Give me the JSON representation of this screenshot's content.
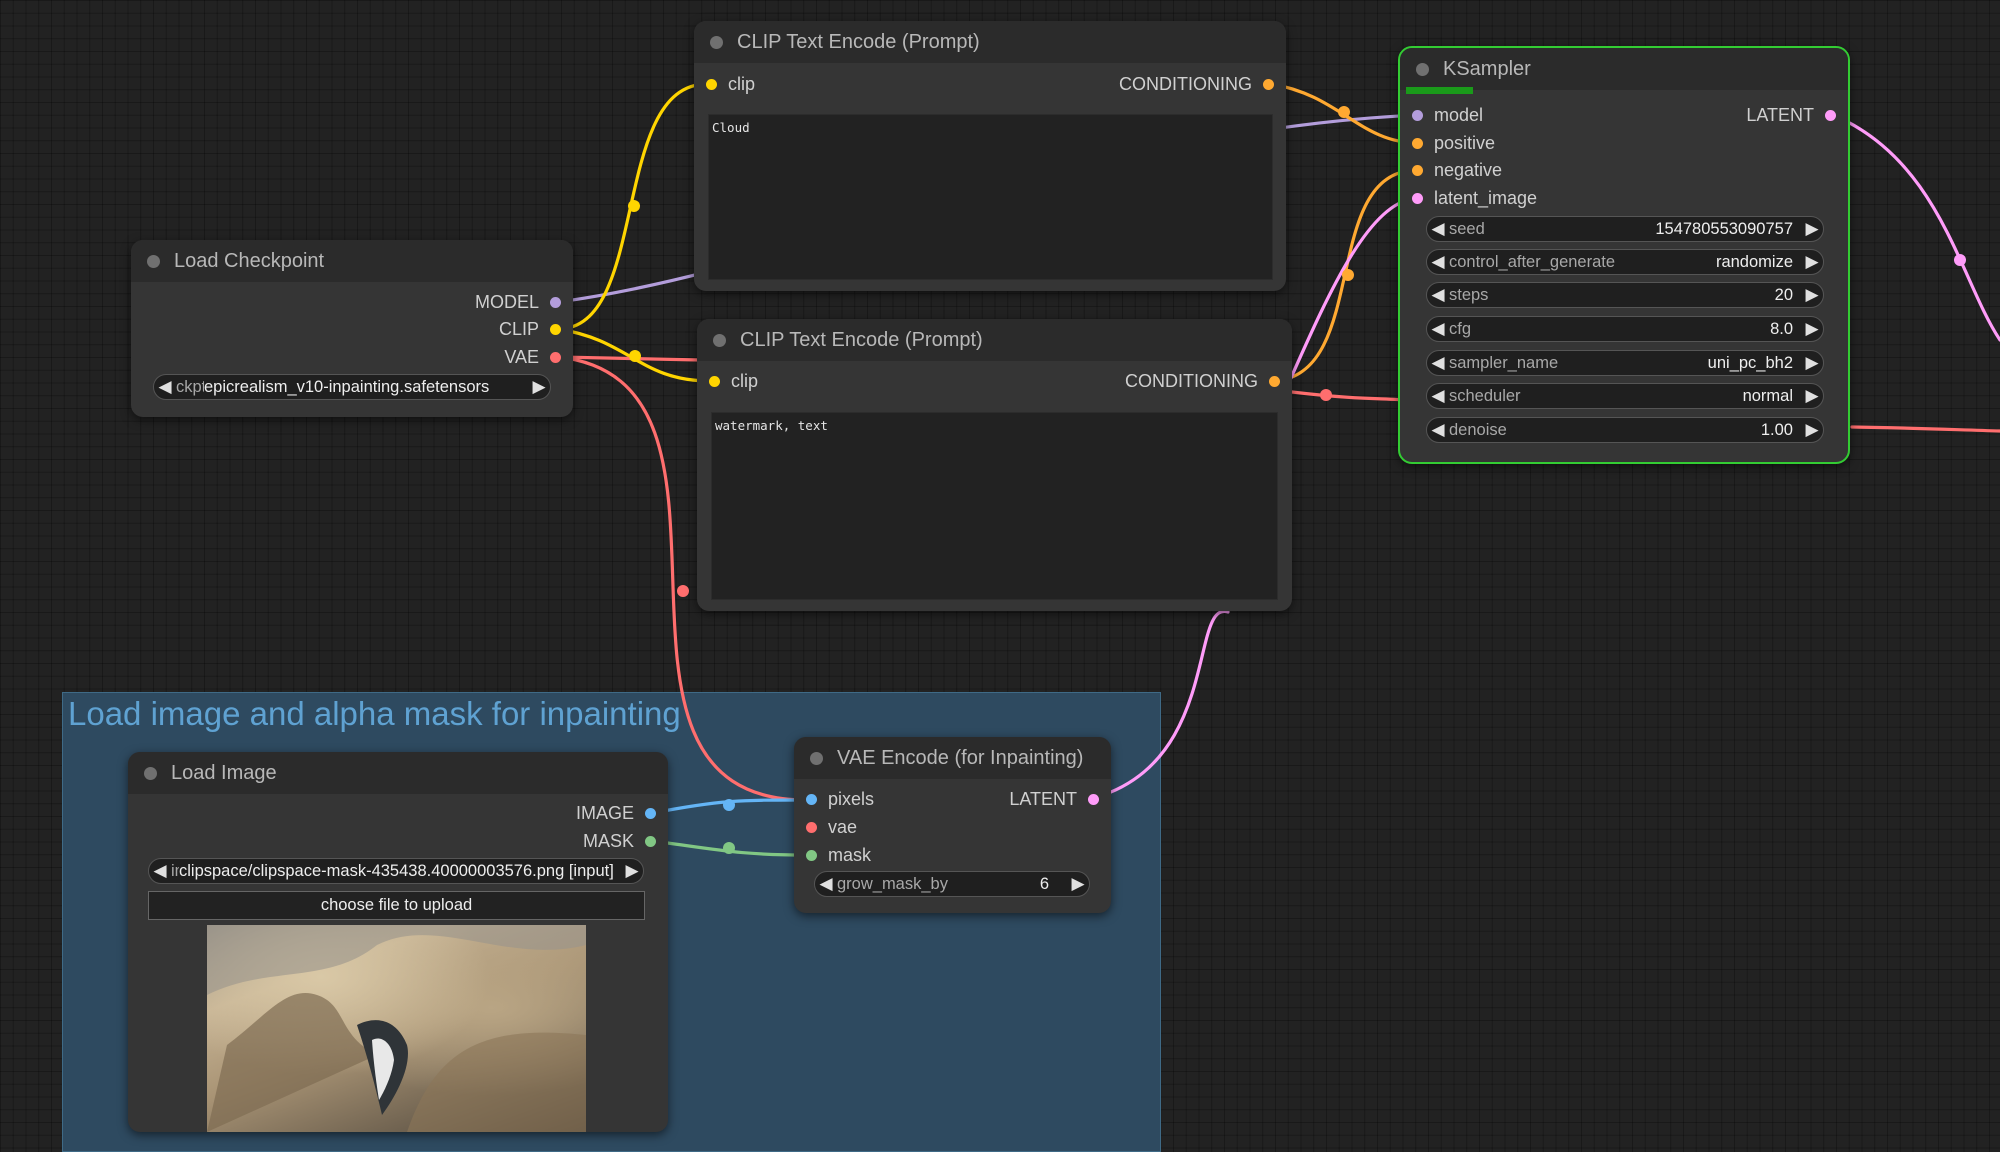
{
  "group": {
    "title": "Load image and alpha mask for inpainting"
  },
  "colors": {
    "model": "#b39ddb",
    "clip": "#ffd500",
    "vae": "#ff6e6e",
    "conditioning": "#ffa931",
    "latent": "#ff9cf9",
    "image": "#64b5f6",
    "mask": "#81c784",
    "selected_border": "#33cc33",
    "group_fill": "#2e4a60",
    "group_title": "#5fa2d2"
  },
  "load_checkpoint": {
    "title": "Load Checkpoint",
    "outputs": {
      "model": "MODEL",
      "clip": "CLIP",
      "vae": "VAE"
    },
    "ckpt": {
      "label": "ckpt_name",
      "value": "epicrealism_v10-inpainting.safetensors"
    }
  },
  "clip_pos": {
    "title": "CLIP Text Encode (Prompt)",
    "input": "clip",
    "output": "CONDITIONING",
    "text": "Cloud"
  },
  "clip_neg": {
    "title": "CLIP Text Encode (Prompt)",
    "input": "clip",
    "output": "CONDITIONING",
    "text": "watermark, text"
  },
  "ksampler": {
    "title": "KSampler",
    "inputs": {
      "model": "model",
      "positive": "positive",
      "negative": "negative",
      "latent_image": "latent_image"
    },
    "output": "LATENT",
    "progress": 0.15,
    "widgets": [
      {
        "label": "seed",
        "value": "154780553090757"
      },
      {
        "label": "control_after_generate",
        "value": "randomize"
      },
      {
        "label": "steps",
        "value": "20"
      },
      {
        "label": "cfg",
        "value": "8.0"
      },
      {
        "label": "sampler_name",
        "value": "uni_pc_bh2"
      },
      {
        "label": "scheduler",
        "value": "normal"
      },
      {
        "label": "denoise",
        "value": "1.00"
      }
    ]
  },
  "vae_encode": {
    "title": "VAE Encode (for Inpainting)",
    "inputs": {
      "pixels": "pixels",
      "vae": "vae",
      "mask": "mask"
    },
    "output": "LATENT",
    "grow": {
      "label": "grow_mask_by",
      "value": "6"
    }
  },
  "load_image": {
    "title": "Load Image",
    "outputs": {
      "image": "IMAGE",
      "mask": "MASK"
    },
    "image_widget": {
      "label": "image",
      "value": "clipspace/clipspace-mask-435438.40000003576.png [input]"
    },
    "upload_label": "choose file to upload"
  },
  "icons": {
    "arrow_left": "◀",
    "arrow_right": "▶"
  }
}
